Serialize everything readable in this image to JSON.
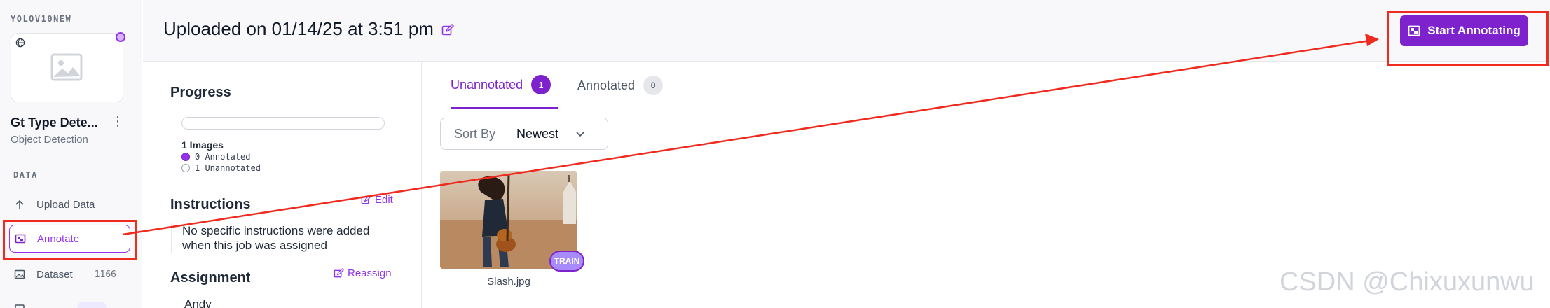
{
  "sidebar": {
    "workspace_name": "YOLOV10NEW",
    "project_name": "Gt Type Dete...",
    "project_type": "Object Detection",
    "section_label": "DATA",
    "items": [
      {
        "label": "Upload Data",
        "icon": "upload-arrow-icon"
      },
      {
        "label": "Annotate",
        "icon": "annotate-icon",
        "active": true
      },
      {
        "label": "Dataset",
        "icon": "image-icon",
        "count": "1166"
      },
      {
        "label": "Versions",
        "icon": "versions-icon"
      }
    ]
  },
  "header": {
    "title": "Uploaded on 01/14/25 at 3:51 pm",
    "start_button_label": "Start Annotating"
  },
  "panel": {
    "progress_title": "Progress",
    "progress_fraction": 0,
    "images_count": "1 Images",
    "legend": [
      {
        "label": "0 Annotated",
        "color": "#9333ea"
      },
      {
        "label": "1 Unannotated",
        "color": "#ffffff"
      }
    ],
    "instructions_title": "Instructions",
    "edit_label": "Edit",
    "instructions_text": "No specific instructions were added when this job was assigned",
    "assignment_title": "Assignment",
    "reassign_label": "Reassign",
    "assignee": "Andy"
  },
  "main": {
    "tabs": [
      {
        "label": "Unannotated",
        "count": "1",
        "active": true
      },
      {
        "label": "Annotated",
        "count": "0"
      }
    ],
    "sort_label": "Sort By",
    "sort_value": "Newest",
    "images": [
      {
        "filename": "Slash.jpg",
        "split_badge": "TRAIN"
      }
    ]
  },
  "watermark": "CSDN @Chixuxunwu",
  "colors": {
    "accent": "#7e22ce",
    "highlight": "#ef2a1e"
  }
}
